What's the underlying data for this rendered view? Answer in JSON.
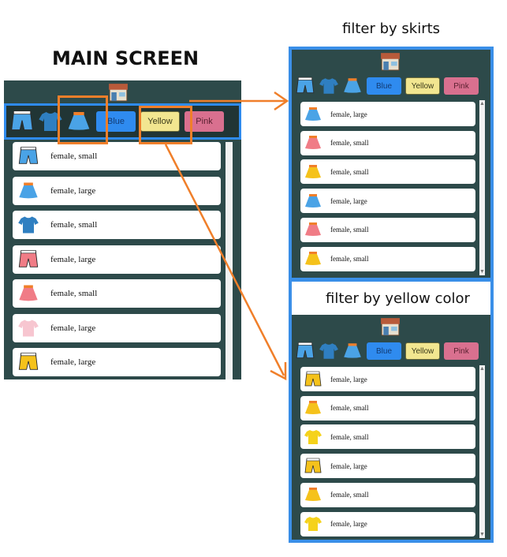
{
  "headings": {
    "main_title": "MAIN SCREEN",
    "skirts_caption": "filter by skirts",
    "yellow_caption": "filter by yellow color"
  },
  "filters": {
    "icons": [
      "shorts-icon",
      "tshirt-icon",
      "skirt-icon"
    ],
    "colors": [
      {
        "label": "Blue",
        "color": "#2f8bef"
      },
      {
        "label": "Yellow",
        "color": "#f2e690"
      },
      {
        "label": "Pink",
        "color": "#d9708f"
      }
    ]
  },
  "screens": {
    "main": {
      "items": [
        {
          "icon": "shorts",
          "color": "#4aa3e6",
          "label": "female, small"
        },
        {
          "icon": "skirt",
          "color": "#4aa3e6",
          "label": "female, large"
        },
        {
          "icon": "tshirt",
          "color": "#2f7fc1",
          "label": "female, small"
        },
        {
          "icon": "shorts",
          "color": "#f07c86",
          "label": "female, large"
        },
        {
          "icon": "skirt",
          "color": "#f07c86",
          "label": "female, small"
        },
        {
          "icon": "tshirt",
          "color": "#f7c6d0",
          "label": "female, large"
        },
        {
          "icon": "shorts",
          "color": "#f5c21b",
          "label": "female, large"
        }
      ]
    },
    "skirts": {
      "items": [
        {
          "icon": "skirt",
          "color": "#4aa3e6",
          "label": "female, large"
        },
        {
          "icon": "skirt",
          "color": "#f07c86",
          "label": "female, small"
        },
        {
          "icon": "skirt",
          "color": "#f5c21b",
          "label": "female, small"
        },
        {
          "icon": "skirt",
          "color": "#4aa3e6",
          "label": "female, large"
        },
        {
          "icon": "skirt",
          "color": "#f07c86",
          "label": "female, small"
        },
        {
          "icon": "skirt",
          "color": "#f5c21b",
          "label": "female, small"
        }
      ]
    },
    "yellow": {
      "items": [
        {
          "icon": "shorts",
          "color": "#f5c21b",
          "label": "female, large"
        },
        {
          "icon": "skirt",
          "color": "#f5c21b",
          "label": "female, small"
        },
        {
          "icon": "tshirt",
          "color": "#f5d21b",
          "label": "female, small"
        },
        {
          "icon": "shorts",
          "color": "#f5c21b",
          "label": "female, large"
        },
        {
          "icon": "skirt",
          "color": "#f5c21b",
          "label": "female, small"
        },
        {
          "icon": "tshirt",
          "color": "#f5d21b",
          "label": "female, large"
        }
      ]
    }
  },
  "colors": {
    "panel_bg": "#2d4a4a",
    "highlight_blue": "#3a8fe8",
    "annotation_orange": "#f07f2a"
  }
}
